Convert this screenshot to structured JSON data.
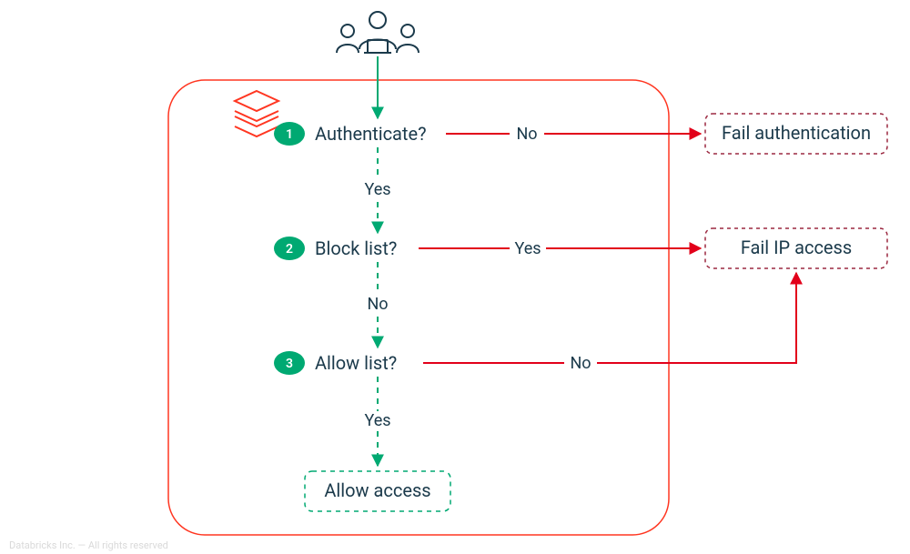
{
  "steps": [
    {
      "num": "1",
      "label": "Authenticate?",
      "yes": "Yes",
      "no": "No"
    },
    {
      "num": "2",
      "label": "Block list?",
      "yes": "Yes",
      "no": "No"
    },
    {
      "num": "3",
      "label": "Allow list?",
      "yes": "Yes",
      "no": "No"
    }
  ],
  "outcomes": {
    "fail_auth": "Fail authentication",
    "fail_ip": "Fail IP access",
    "allow": "Allow access"
  },
  "colors": {
    "container": "#FF3621",
    "green": "#00A972",
    "red": "#E2001A",
    "maroon_dash": "#9b2840",
    "text": "#1b3a4b"
  },
  "watermark": "Databricks Inc. — All rights reserved"
}
